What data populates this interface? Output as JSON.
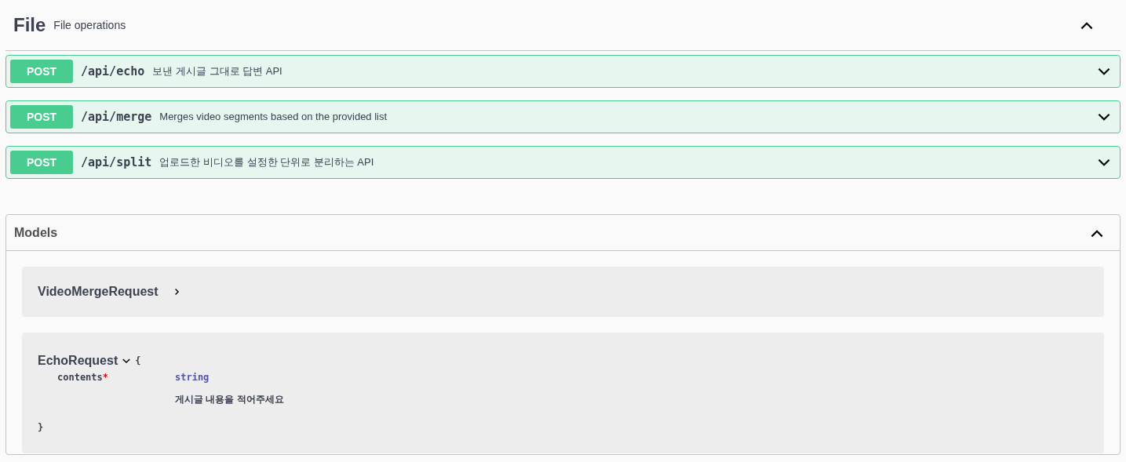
{
  "section": {
    "name": "File",
    "description": "File operations",
    "expanded": true
  },
  "operations": [
    {
      "method": "POST",
      "path": "/api/echo",
      "summary": "보낸 게시글 그대로 답변 API",
      "expanded": false
    },
    {
      "method": "POST",
      "path": "/api/merge",
      "summary": "Merges video segments based on the provided list",
      "expanded": false
    },
    {
      "method": "POST",
      "path": "/api/split",
      "summary": "업로드한 비디오를 설정한 단위로 분리하는 API",
      "expanded": false
    }
  ],
  "models": {
    "title": "Models",
    "expanded": true,
    "items": [
      {
        "name": "VideoMergeRequest",
        "expanded": false
      },
      {
        "name": "EchoRequest",
        "expanded": true,
        "open_brace": "{",
        "close_brace": "}",
        "properties": [
          {
            "name": "contents",
            "required": true,
            "required_mark": "*",
            "type": "string",
            "description": "게시글 내용을 적어주세요"
          }
        ]
      }
    ]
  }
}
